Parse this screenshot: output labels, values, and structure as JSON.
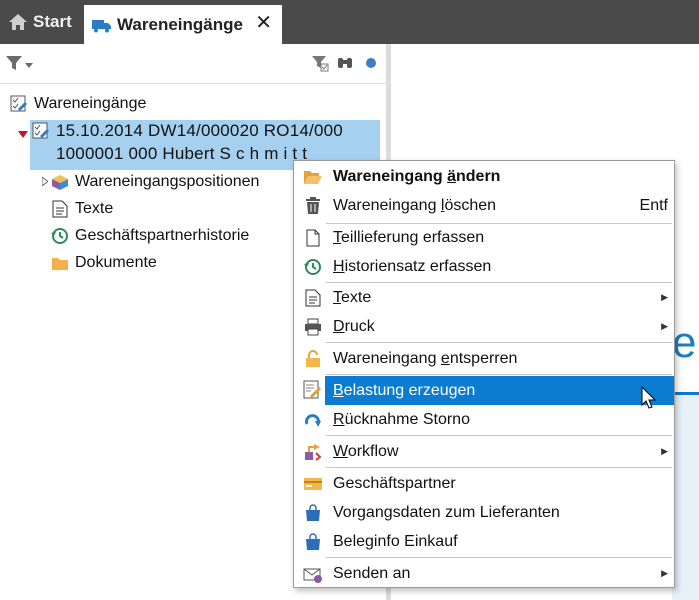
{
  "tabs": {
    "start_label": "Start",
    "active_label": "Wareneingänge",
    "close_glyph": "✕"
  },
  "tree": {
    "root_label": "Wareneingänge",
    "selected_line1": "15.10.2014 DW14/000020 RO14/000",
    "selected_line2": "1000001 000 Hubert S c h m i t t",
    "children": [
      {
        "label": "Wareneingangspositionen",
        "icon": "package-icon"
      },
      {
        "label": "Texte",
        "icon": "document-icon"
      },
      {
        "label": "Geschäftspartnerhistorie",
        "icon": "history-icon"
      },
      {
        "label": "Dokumente",
        "icon": "folder-icon"
      }
    ]
  },
  "menu": {
    "items": [
      {
        "pre": "Wareneingang ",
        "ul": "ä",
        "post": "ndern",
        "icon": "folder-open-icon",
        "bold": true
      },
      {
        "pre": "Wareneingang ",
        "ul": "l",
        "post": "öschen",
        "icon": "trash-icon",
        "shortcut": "Entf"
      },
      {
        "pre": "",
        "ul": "T",
        "post": "eillieferung erfassen",
        "icon": "page-icon"
      },
      {
        "pre": "",
        "ul": "H",
        "post": "istoriensatz erfassen",
        "icon": "history-icon"
      },
      {
        "pre": "",
        "ul": "T",
        "post": "exte",
        "icon": "document-icon",
        "submenu": true
      },
      {
        "pre": "",
        "ul": "D",
        "post": "ruck",
        "icon": "printer-icon",
        "submenu": true
      },
      {
        "pre": "Wareneingang ",
        "ul": "e",
        "post": "ntsperren",
        "icon": "unlock-icon"
      },
      {
        "pre": "",
        "ul": "B",
        "post": "elastung erzeugen",
        "icon": "edit-document-icon",
        "highlight": true
      },
      {
        "pre": "",
        "ul": "R",
        "post": "ücknahme Storno",
        "icon": "undo-arrow-icon"
      },
      {
        "pre": "",
        "ul": "W",
        "post": "orkflow",
        "icon": "workflow-icon",
        "submenu": true
      },
      {
        "pre": "Geschäftspartner",
        "ul": "",
        "post": "",
        "icon": "card-icon"
      },
      {
        "pre": "Vorgangsdaten zum Lieferanten",
        "ul": "",
        "post": "",
        "icon": "bag-icon"
      },
      {
        "pre": "Beleginfo Einkauf",
        "ul": "",
        "post": "",
        "icon": "bag-icon"
      },
      {
        "pre": "Senden an",
        "ul": "",
        "post": "",
        "icon": "mail-icon",
        "submenu": true
      }
    ],
    "submenu_glyph": "▶"
  },
  "right_pane": {
    "partial_text": "er"
  },
  "colors": {
    "tabbar": "#4a4a4a",
    "selection": "#a5d0ef",
    "highlight": "#0b7ccf",
    "accent_blue": "#1b7fc4"
  }
}
